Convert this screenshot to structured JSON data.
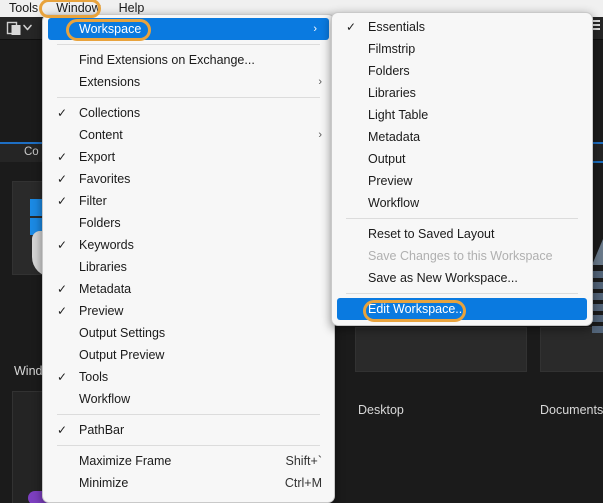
{
  "menubar": {
    "items": [
      {
        "label": "Tools",
        "annotated": false
      },
      {
        "label": "Window",
        "annotated": true
      },
      {
        "label": "Help",
        "annotated": false
      }
    ]
  },
  "toolbar": {
    "copy_icon": "copy-layers-icon",
    "dropdown_icon": "chevron-down-icon"
  },
  "background": {
    "panel_header_label": "Co",
    "hamburger_icon": "hamburger-menu-icon",
    "thumbnails": [
      {
        "label": "Wind",
        "kind": "windows-logo"
      },
      {
        "label": "Desktop",
        "kind": "photo"
      },
      {
        "label": "Documents",
        "kind": "photo"
      }
    ]
  },
  "window_menu": {
    "name": "Window",
    "items": [
      {
        "label": "Workspace",
        "checked": false,
        "submenu": true,
        "selected": true,
        "annotated": true
      },
      {
        "separator": true
      },
      {
        "label": "Find Extensions on Exchange...",
        "checked": false,
        "submenu": false
      },
      {
        "label": "Extensions",
        "checked": false,
        "submenu": true
      },
      {
        "separator": true
      },
      {
        "label": "Collections",
        "checked": true,
        "submenu": false
      },
      {
        "label": "Content",
        "checked": false,
        "submenu": true
      },
      {
        "label": "Export",
        "checked": true,
        "submenu": false
      },
      {
        "label": "Favorites",
        "checked": true,
        "submenu": false
      },
      {
        "label": "Filter",
        "checked": true,
        "submenu": false
      },
      {
        "label": "Folders",
        "checked": false,
        "submenu": false
      },
      {
        "label": "Keywords",
        "checked": true,
        "submenu": false
      },
      {
        "label": "Libraries",
        "checked": false,
        "submenu": false
      },
      {
        "label": "Metadata",
        "checked": true,
        "submenu": false
      },
      {
        "label": "Preview",
        "checked": true,
        "submenu": false
      },
      {
        "label": "Output Settings",
        "checked": false,
        "submenu": false
      },
      {
        "label": "Output Preview",
        "checked": false,
        "submenu": false
      },
      {
        "label": "Tools",
        "checked": true,
        "submenu": false
      },
      {
        "label": "Workflow",
        "checked": false,
        "submenu": false
      },
      {
        "separator": true
      },
      {
        "label": "PathBar",
        "checked": true,
        "submenu": false
      },
      {
        "separator": true
      },
      {
        "label": "Maximize Frame",
        "checked": false,
        "submenu": false,
        "accel": "Shift+`"
      },
      {
        "label": "Minimize",
        "checked": false,
        "submenu": false,
        "accel": "Ctrl+M"
      }
    ]
  },
  "workspace_menu": {
    "name": "Workspace",
    "items": [
      {
        "label": "Essentials",
        "checked": true
      },
      {
        "label": "Filmstrip",
        "checked": false
      },
      {
        "label": "Folders",
        "checked": false
      },
      {
        "label": "Libraries",
        "checked": false
      },
      {
        "label": "Light Table",
        "checked": false
      },
      {
        "label": "Metadata",
        "checked": false
      },
      {
        "label": "Output",
        "checked": false
      },
      {
        "label": "Preview",
        "checked": false
      },
      {
        "label": "Workflow",
        "checked": false
      },
      {
        "separator": true
      },
      {
        "label": "Reset to Saved Layout",
        "checked": false
      },
      {
        "label": "Save Changes to this Workspace",
        "checked": false,
        "disabled": true
      },
      {
        "label": "Save as New Workspace...",
        "checked": false
      },
      {
        "separator": true
      },
      {
        "label": "Edit Workspace...",
        "checked": false,
        "selected": true,
        "annotated": true
      }
    ]
  },
  "glyphs": {
    "check": "✓",
    "chevron_right": "›"
  },
  "colors": {
    "accent_blue": "#0a7ae0",
    "annotation_orange": "#e8a33d",
    "menu_bg": "#f7f7f7",
    "app_bg": "#1b1b1b"
  }
}
